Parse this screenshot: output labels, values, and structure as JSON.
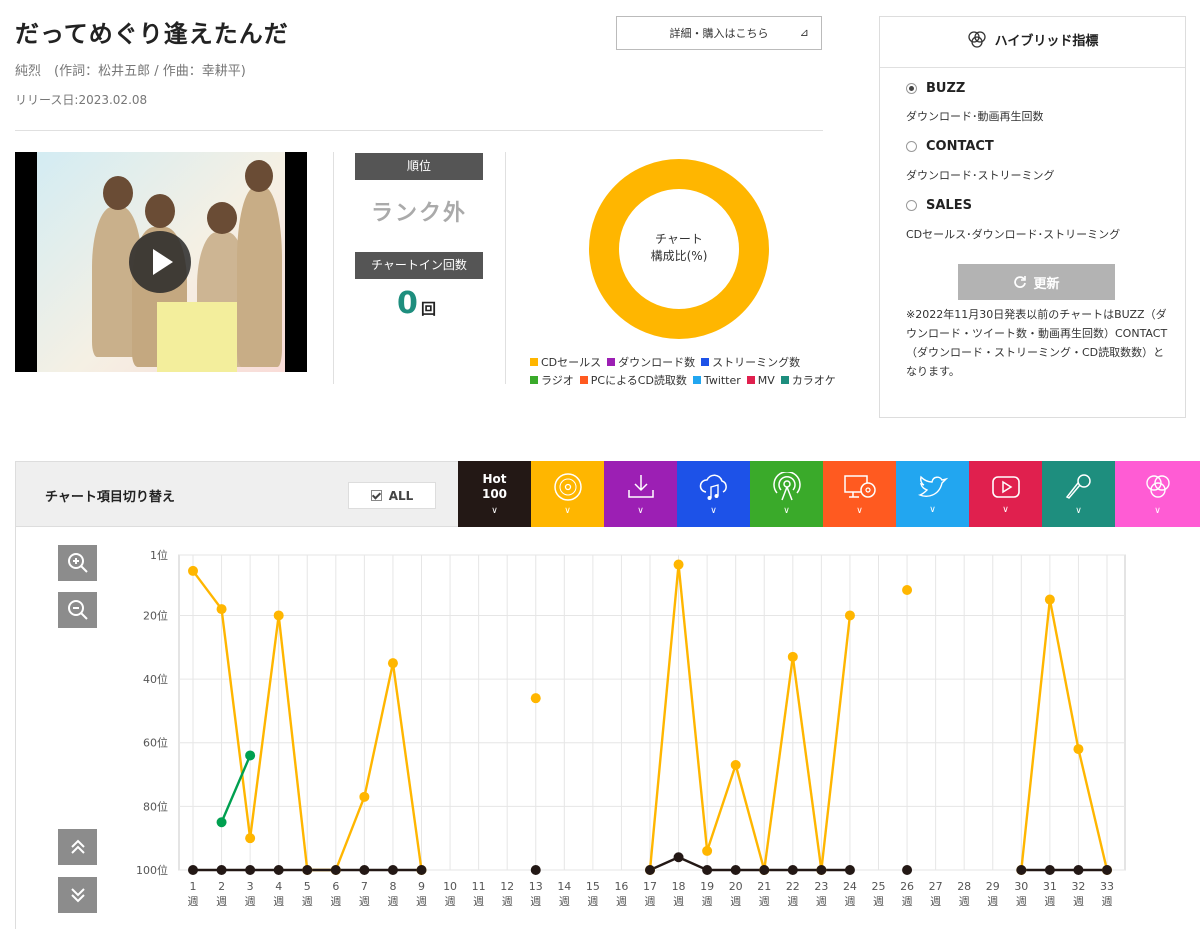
{
  "song": {
    "title": "だってめぐり逢えたんだ",
    "credits": "純烈　(作詞：松井五郎 / 作曲：幸耕平)",
    "release": "リリース日:2023.02.08",
    "buy_label": "詳細・購入はこちら",
    "buy_arrow": "⊿"
  },
  "stats": {
    "rank_label": "順位",
    "rank_value": "ランク外",
    "chartin_label": "チャートイン回数",
    "chartin_count": "0",
    "chartin_unit": "回"
  },
  "donut": {
    "line1": "チャート",
    "line2": "構成比(%)",
    "color": "#FFB600",
    "legend_row1": [
      {
        "label": "CDセールス",
        "color": "#FFB600"
      },
      {
        "label": "ダウンロード数",
        "color": "#9C1FB4"
      },
      {
        "label": "ストリーミング数",
        "color": "#1D52E8"
      }
    ],
    "legend_row2": [
      {
        "label": "ラジオ",
        "color": "#3AAA2A"
      },
      {
        "label": "PCによるCD読取数",
        "color": "#FF5A20"
      },
      {
        "label": "Twitter",
        "color": "#22A6F0"
      },
      {
        "label": "MV",
        "color": "#E0204E"
      },
      {
        "label": "カラオケ",
        "color": "#1E8E7E"
      }
    ]
  },
  "hybrid": {
    "title": "ハイブリッド指標",
    "options": [
      {
        "label": "BUZZ",
        "desc": "ダウンロード･動画再生回数",
        "selected": true
      },
      {
        "label": "CONTACT",
        "desc": "ダウンロード･ストリーミング",
        "selected": false
      },
      {
        "label": "SALES",
        "desc": "CDセールス･ダウンロード･ストリーミング",
        "selected": false
      }
    ],
    "refresh_label": "更新",
    "note": "※2022年11月30日発表以前のチャートはBUZZ（ダウンロード・ツイート数・動画再生回数）CONTACT（ダウンロード・ストリーミング・CD読取数数）となります。"
  },
  "switcher": {
    "label": "チャート項目切り替え",
    "all_label": "ALL",
    "hot_line1": "Hot",
    "hot_line2": "100",
    "tabs": [
      {
        "name": "hot100",
        "color": "#231815"
      },
      {
        "name": "cd-sales",
        "icon": "disc-icon",
        "color": "#FFB600"
      },
      {
        "name": "download",
        "icon": "download-icon",
        "color": "#9C1FB4"
      },
      {
        "name": "streaming",
        "icon": "cloud-music-icon",
        "color": "#1D52E8"
      },
      {
        "name": "radio",
        "icon": "radio-icon",
        "color": "#3AAA2A"
      },
      {
        "name": "pc-cd-read",
        "icon": "pc-disc-icon",
        "color": "#FF5A20"
      },
      {
        "name": "twitter",
        "icon": "twitter-icon",
        "color": "#22A6F0"
      },
      {
        "name": "mv",
        "icon": "youtube-icon",
        "color": "#E0204E"
      },
      {
        "name": "karaoke",
        "icon": "microphone-icon",
        "color": "#1E8E7E"
      },
      {
        "name": "hybrid",
        "icon": "hybrid-icon",
        "color": "#FF5CD4"
      }
    ]
  },
  "chart_data": {
    "type": "line",
    "y_reversed": true,
    "ylim": [
      1,
      100
    ],
    "y_ticks": [
      "1位",
      "20位",
      "40位",
      "60位",
      "80位",
      "100位"
    ],
    "y_tick_values": [
      1,
      20,
      40,
      60,
      80,
      100
    ],
    "x": [
      1,
      2,
      3,
      4,
      5,
      6,
      7,
      8,
      9,
      10,
      11,
      12,
      13,
      14,
      15,
      16,
      17,
      18,
      19,
      20,
      21,
      22,
      23,
      24,
      25,
      26,
      27,
      28,
      29,
      30,
      31,
      32,
      33
    ],
    "x_tick_suffix": "週",
    "grid": true,
    "series": [
      {
        "key": "cd",
        "color": "#FFB600",
        "values": [
          6,
          18,
          90,
          20,
          100,
          100,
          77,
          35,
          100,
          null,
          null,
          null,
          46,
          null,
          null,
          null,
          100,
          4,
          94,
          67,
          100,
          33,
          100,
          20,
          null,
          12,
          null,
          null,
          null,
          100,
          15,
          62,
          100
        ]
      },
      {
        "key": "hot100",
        "color": "#231815",
        "values": [
          100,
          100,
          100,
          100,
          100,
          100,
          100,
          100,
          100,
          null,
          null,
          null,
          100,
          null,
          null,
          null,
          100,
          96,
          100,
          100,
          100,
          100,
          100,
          100,
          null,
          100,
          null,
          null,
          null,
          100,
          100,
          100,
          100
        ]
      },
      {
        "key": "radio",
        "color": "#00A050",
        "values": [
          null,
          85,
          64,
          null,
          null,
          null,
          null,
          null,
          null,
          null,
          null,
          null,
          null,
          null,
          null,
          null,
          null,
          null,
          null,
          null,
          null,
          null,
          null,
          null,
          null,
          null,
          null,
          null,
          null,
          null,
          null,
          null,
          null
        ]
      }
    ]
  }
}
